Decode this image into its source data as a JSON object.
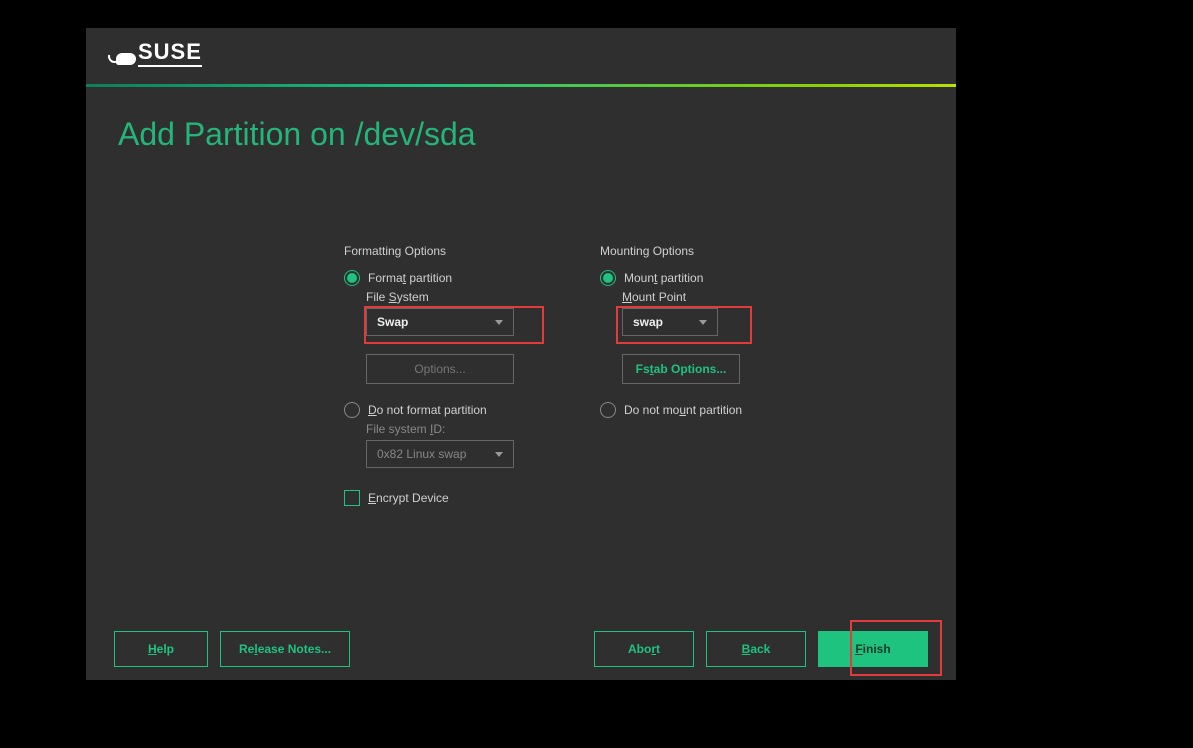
{
  "brand": "SUSE",
  "title": "Add Partition on /dev/sda",
  "formatting": {
    "header": "Formatting Options",
    "format_label_pre": "Forma",
    "format_label_u": "t",
    "format_label_post": " partition",
    "fs_label_pre": "File ",
    "fs_label_u": "S",
    "fs_label_post": "ystem",
    "fs_value": "Swap",
    "options_btn": "Options...",
    "noformat_label_pre": "",
    "noformat_label_u": "D",
    "noformat_label_post": "o not format partition",
    "fsid_label_pre": "File system ",
    "fsid_label_u": "I",
    "fsid_label_post": "D:",
    "fsid_value": "0x82 Linux swap",
    "encrypt_pre": "",
    "encrypt_u": "E",
    "encrypt_post": "ncrypt Device"
  },
  "mounting": {
    "header": "Mounting Options",
    "mount_label_pre": "Moun",
    "mount_label_u": "t",
    "mount_label_post": " partition",
    "mp_label_pre": "",
    "mp_label_u": "M",
    "mp_label_post": "ount Point",
    "mp_value": "swap",
    "fstab_pre": "Fs",
    "fstab_u": "t",
    "fstab_post": "ab Options...",
    "nomount_pre": "Do not mo",
    "nomount_u": "u",
    "nomount_post": "nt partition"
  },
  "footer": {
    "help_u": "H",
    "help_post": "elp",
    "release_pre": "Re",
    "release_u": "l",
    "release_post": "ease Notes...",
    "abort_pre": "Abo",
    "abort_u": "r",
    "abort_post": "t",
    "back_u": "B",
    "back_post": "ack",
    "finish_u": "F",
    "finish_post": "inish"
  }
}
